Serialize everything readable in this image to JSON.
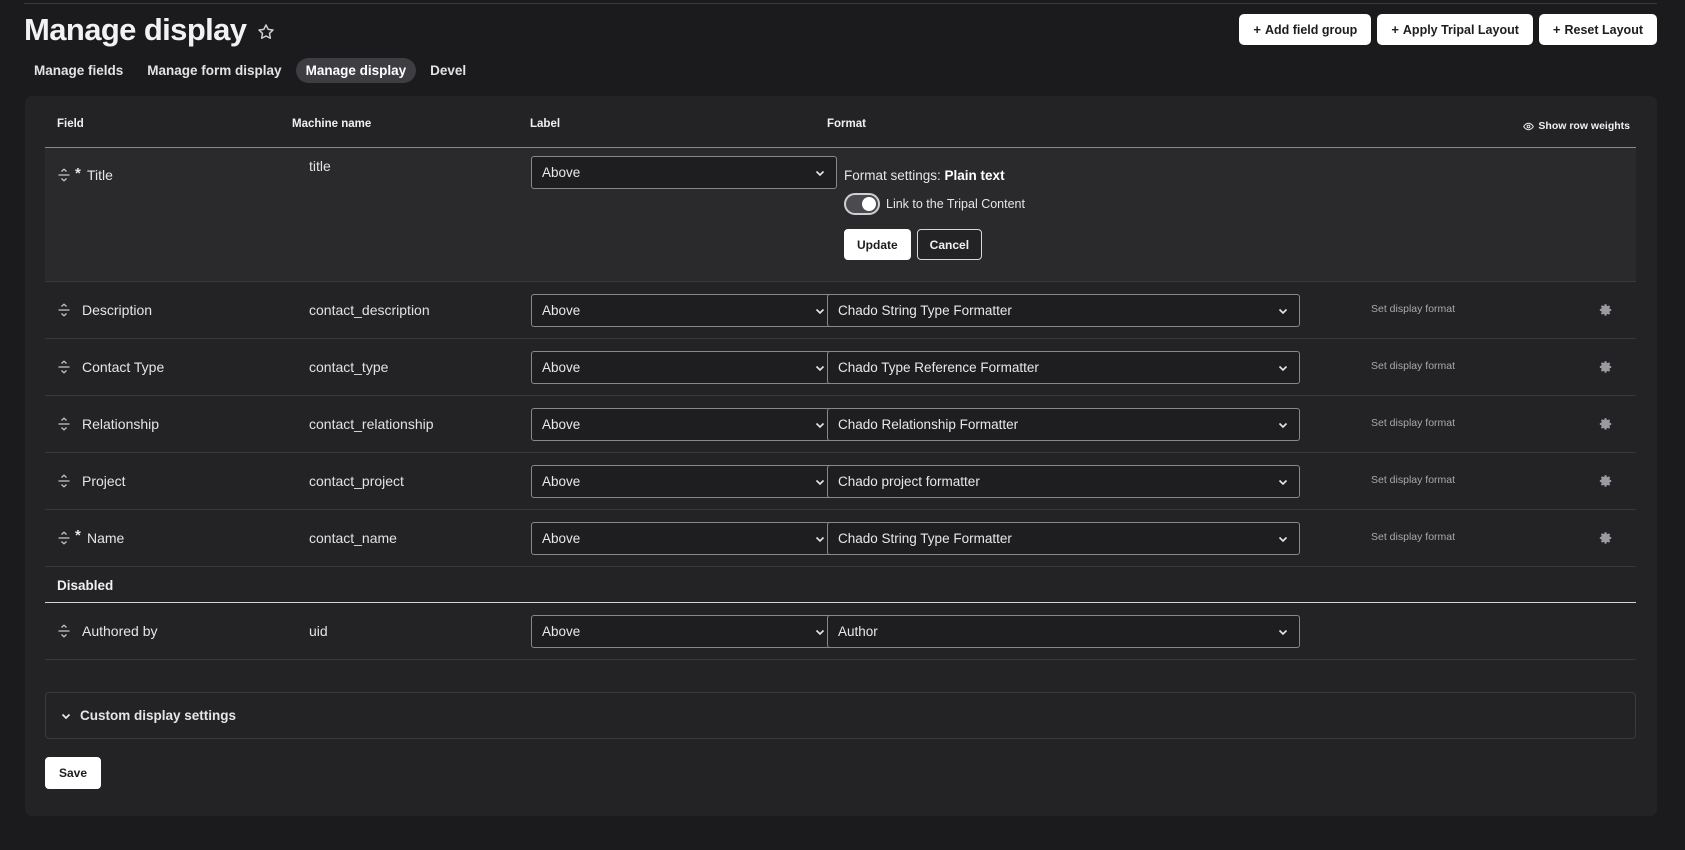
{
  "page": {
    "title": "Manage display"
  },
  "header_actions": [
    {
      "label": "Add field group"
    },
    {
      "label": "Apply Tripal Layout"
    },
    {
      "label": "Reset Layout"
    }
  ],
  "tabs": [
    {
      "label": "Manage fields",
      "active": false
    },
    {
      "label": "Manage form display",
      "active": false
    },
    {
      "label": "Manage display",
      "active": true
    },
    {
      "label": "Devel",
      "active": false
    }
  ],
  "table": {
    "headers": {
      "field": "Field",
      "machine": "Machine name",
      "label": "Label",
      "format": "Format"
    },
    "show_row_weights": "Show row weights",
    "rows": [
      {
        "name": "Title",
        "machine": "title",
        "label": "Above",
        "required": true,
        "expanded": true
      },
      {
        "name": "Description",
        "machine": "contact_description",
        "label": "Above",
        "format": "Chado String Type Formatter",
        "summary": "Set display format"
      },
      {
        "name": "Contact Type",
        "machine": "contact_type",
        "label": "Above",
        "format": "Chado Type Reference Formatter",
        "summary": "Set display format"
      },
      {
        "name": "Relationship",
        "machine": "contact_relationship",
        "label": "Above",
        "format": "Chado Relationship Formatter",
        "summary": "Set display format"
      },
      {
        "name": "Project",
        "machine": "contact_project",
        "label": "Above",
        "format": "Chado project formatter",
        "summary": "Set display format"
      },
      {
        "name": "Name",
        "machine": "contact_name",
        "label": "Above",
        "format": "Chado String Type Formatter",
        "summary": "Set display format",
        "required": true
      }
    ],
    "disabled_region": "Disabled",
    "disabled_rows": [
      {
        "name": "Authored by",
        "machine": "uid",
        "label": "Above",
        "format": "Author"
      }
    ],
    "required_marker": "*"
  },
  "format_settings": {
    "prefix": "Format settings:",
    "format_name": "Plain text",
    "toggle_label": "Link to the Tripal Content",
    "toggle_on": true,
    "update_label": "Update",
    "cancel_label": "Cancel"
  },
  "custom_display_settings": "Custom display settings",
  "save_label": "Save",
  "icons": {
    "favorite": "star-icon",
    "drag": "drag-handle-icon",
    "settings": "gear-icon",
    "dropdown": "chevron-down-icon",
    "visibility": "eye-icon"
  }
}
